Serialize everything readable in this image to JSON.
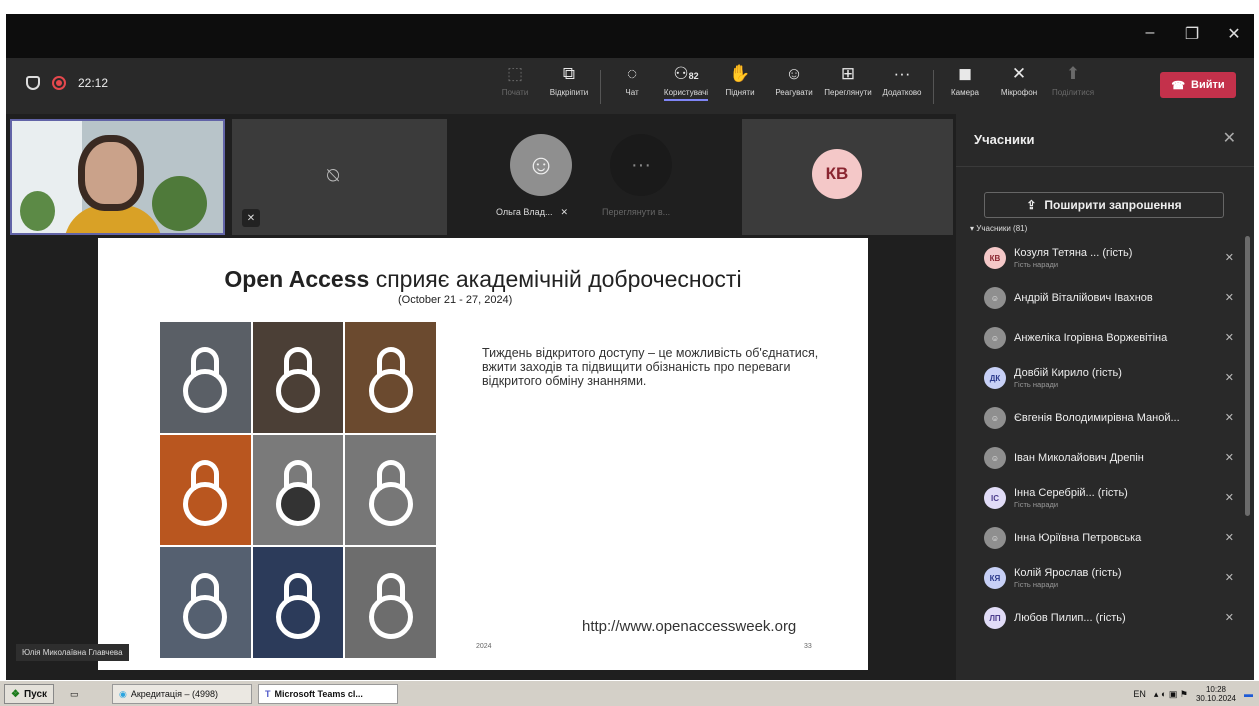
{
  "window": {
    "minimize_icon": "minimize-icon",
    "maximize_icon": "maximize-icon",
    "close_icon": "close-icon"
  },
  "meeting": {
    "timer": "22:12"
  },
  "toolbar": {
    "items": [
      {
        "label": "Почати",
        "icon": "share-screen-icon",
        "dim": true
      },
      {
        "label": "Відкріпити",
        "icon": "pop-out-icon"
      },
      {
        "label": "Чат",
        "icon": "chat-icon"
      },
      {
        "label": "Користувачі",
        "icon": "people-icon",
        "badge": "82",
        "active": true
      },
      {
        "label": "Підняти",
        "icon": "raise-hand-icon"
      },
      {
        "label": "Реагувати",
        "icon": "react-icon"
      },
      {
        "label": "Переглянути",
        "icon": "view-icon"
      },
      {
        "label": "Додатково",
        "icon": "more-icon"
      },
      {
        "label": "Камера",
        "icon": "camera-icon"
      },
      {
        "label": "Мікрофон",
        "icon": "mic-off-icon"
      },
      {
        "label": "Поділитися",
        "icon": "share-icon",
        "dim": true
      }
    ],
    "leave_label": "Вийти"
  },
  "stage": {
    "speaker_name": "Юлія Миколаївна Главчева",
    "olga_name": "Ольга Влад...",
    "more_label": "Переглянути в...",
    "kb_initials": "КВ"
  },
  "slide": {
    "title_bold": "Open Access",
    "title_rest": "сприяє академічній доброчесності",
    "subtitle": "(October 21 - 27, 2024)",
    "text": "Тиждень відкритого доступу – це можливість об'єднатися, вжити заходів та підвищити обізнаність про переваги відкритого обміну знаннями.",
    "url": "http://www.openaccessweek.org",
    "year": "2024",
    "page": "33"
  },
  "panel": {
    "title": "Учасники",
    "share_label": "Поширити запрошення",
    "group_label": "Учасники (81)",
    "participants": [
      {
        "initials": "КВ",
        "name": "Козуля Тетяна ... (гість)",
        "sub": "Гість наради",
        "bg": "#f4c8c8",
        "fg": "#8a2530"
      },
      {
        "initials": "",
        "name": "Андрій Віталійович Івахнов",
        "sub": "",
        "bg": "#8f8f8f",
        "fg": "#eee"
      },
      {
        "initials": "",
        "name": "Анжеліка Ігорівна Воржевітіна",
        "sub": "",
        "bg": "#8f8f8f",
        "fg": "#eee"
      },
      {
        "initials": "ДК",
        "name": "Довбій Кирило (гість)",
        "sub": "Гість наради",
        "bg": "#c7d0f6",
        "fg": "#2b3a8c"
      },
      {
        "initials": "",
        "name": "Євгенія Володимирівна Маной...",
        "sub": "",
        "bg": "#8f8f8f",
        "fg": "#eee"
      },
      {
        "initials": "",
        "name": "Іван Миколайович Дрепін",
        "sub": "",
        "bg": "#8f8f8f",
        "fg": "#eee"
      },
      {
        "initials": "ІС",
        "name": "Інна Серебрій... (гість)",
        "sub": "Гість наради",
        "bg": "#e1dcf7",
        "fg": "#4b3c8c"
      },
      {
        "initials": "",
        "name": "Інна Юріївна Петровська",
        "sub": "",
        "bg": "#8f8f8f",
        "fg": "#eee"
      },
      {
        "initials": "КЯ",
        "name": "Колій Ярослав (гість)",
        "sub": "Гість наради",
        "bg": "#c7d0f6",
        "fg": "#2b3a8c"
      },
      {
        "initials": "ЛП",
        "name": "Любов Пилип... (гість)",
        "sub": "",
        "bg": "#e1dcf7",
        "fg": "#4b3c8c"
      }
    ]
  },
  "taskbar": {
    "start_label": "Пуск",
    "app1": "Акредитація – (4998)",
    "app2": "Microsoft Teams cl...",
    "lang": "EN",
    "time": "10:28",
    "date": "30.10.2024"
  }
}
